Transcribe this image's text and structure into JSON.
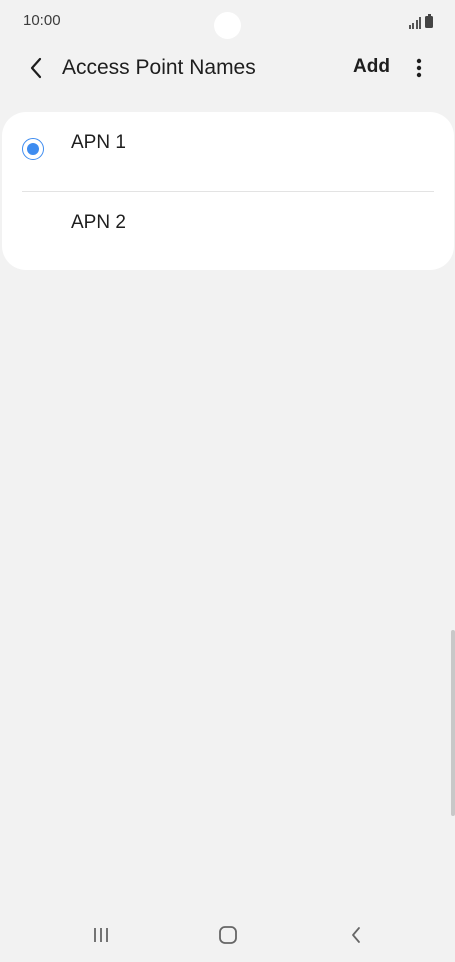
{
  "status_bar": {
    "time": "10:00",
    "icons": [
      "signal-icon",
      "battery-icon"
    ]
  },
  "app_bar": {
    "back_icon": "chevron-left-icon",
    "title": "Access Point Names",
    "add_label": "Add",
    "more_icon": "more-vertical-icon"
  },
  "apn_list": {
    "items": [
      {
        "label": "APN 1",
        "selected": true
      },
      {
        "label": "APN 2",
        "selected": false
      }
    ]
  },
  "nav_bar": {
    "icons": [
      "recent-apps-icon",
      "home-icon",
      "back-icon"
    ]
  },
  "colors": {
    "background": "#f2f2f2",
    "card": "#ffffff",
    "accent": "#3e8cf0",
    "text": "#1e1e1e"
  }
}
